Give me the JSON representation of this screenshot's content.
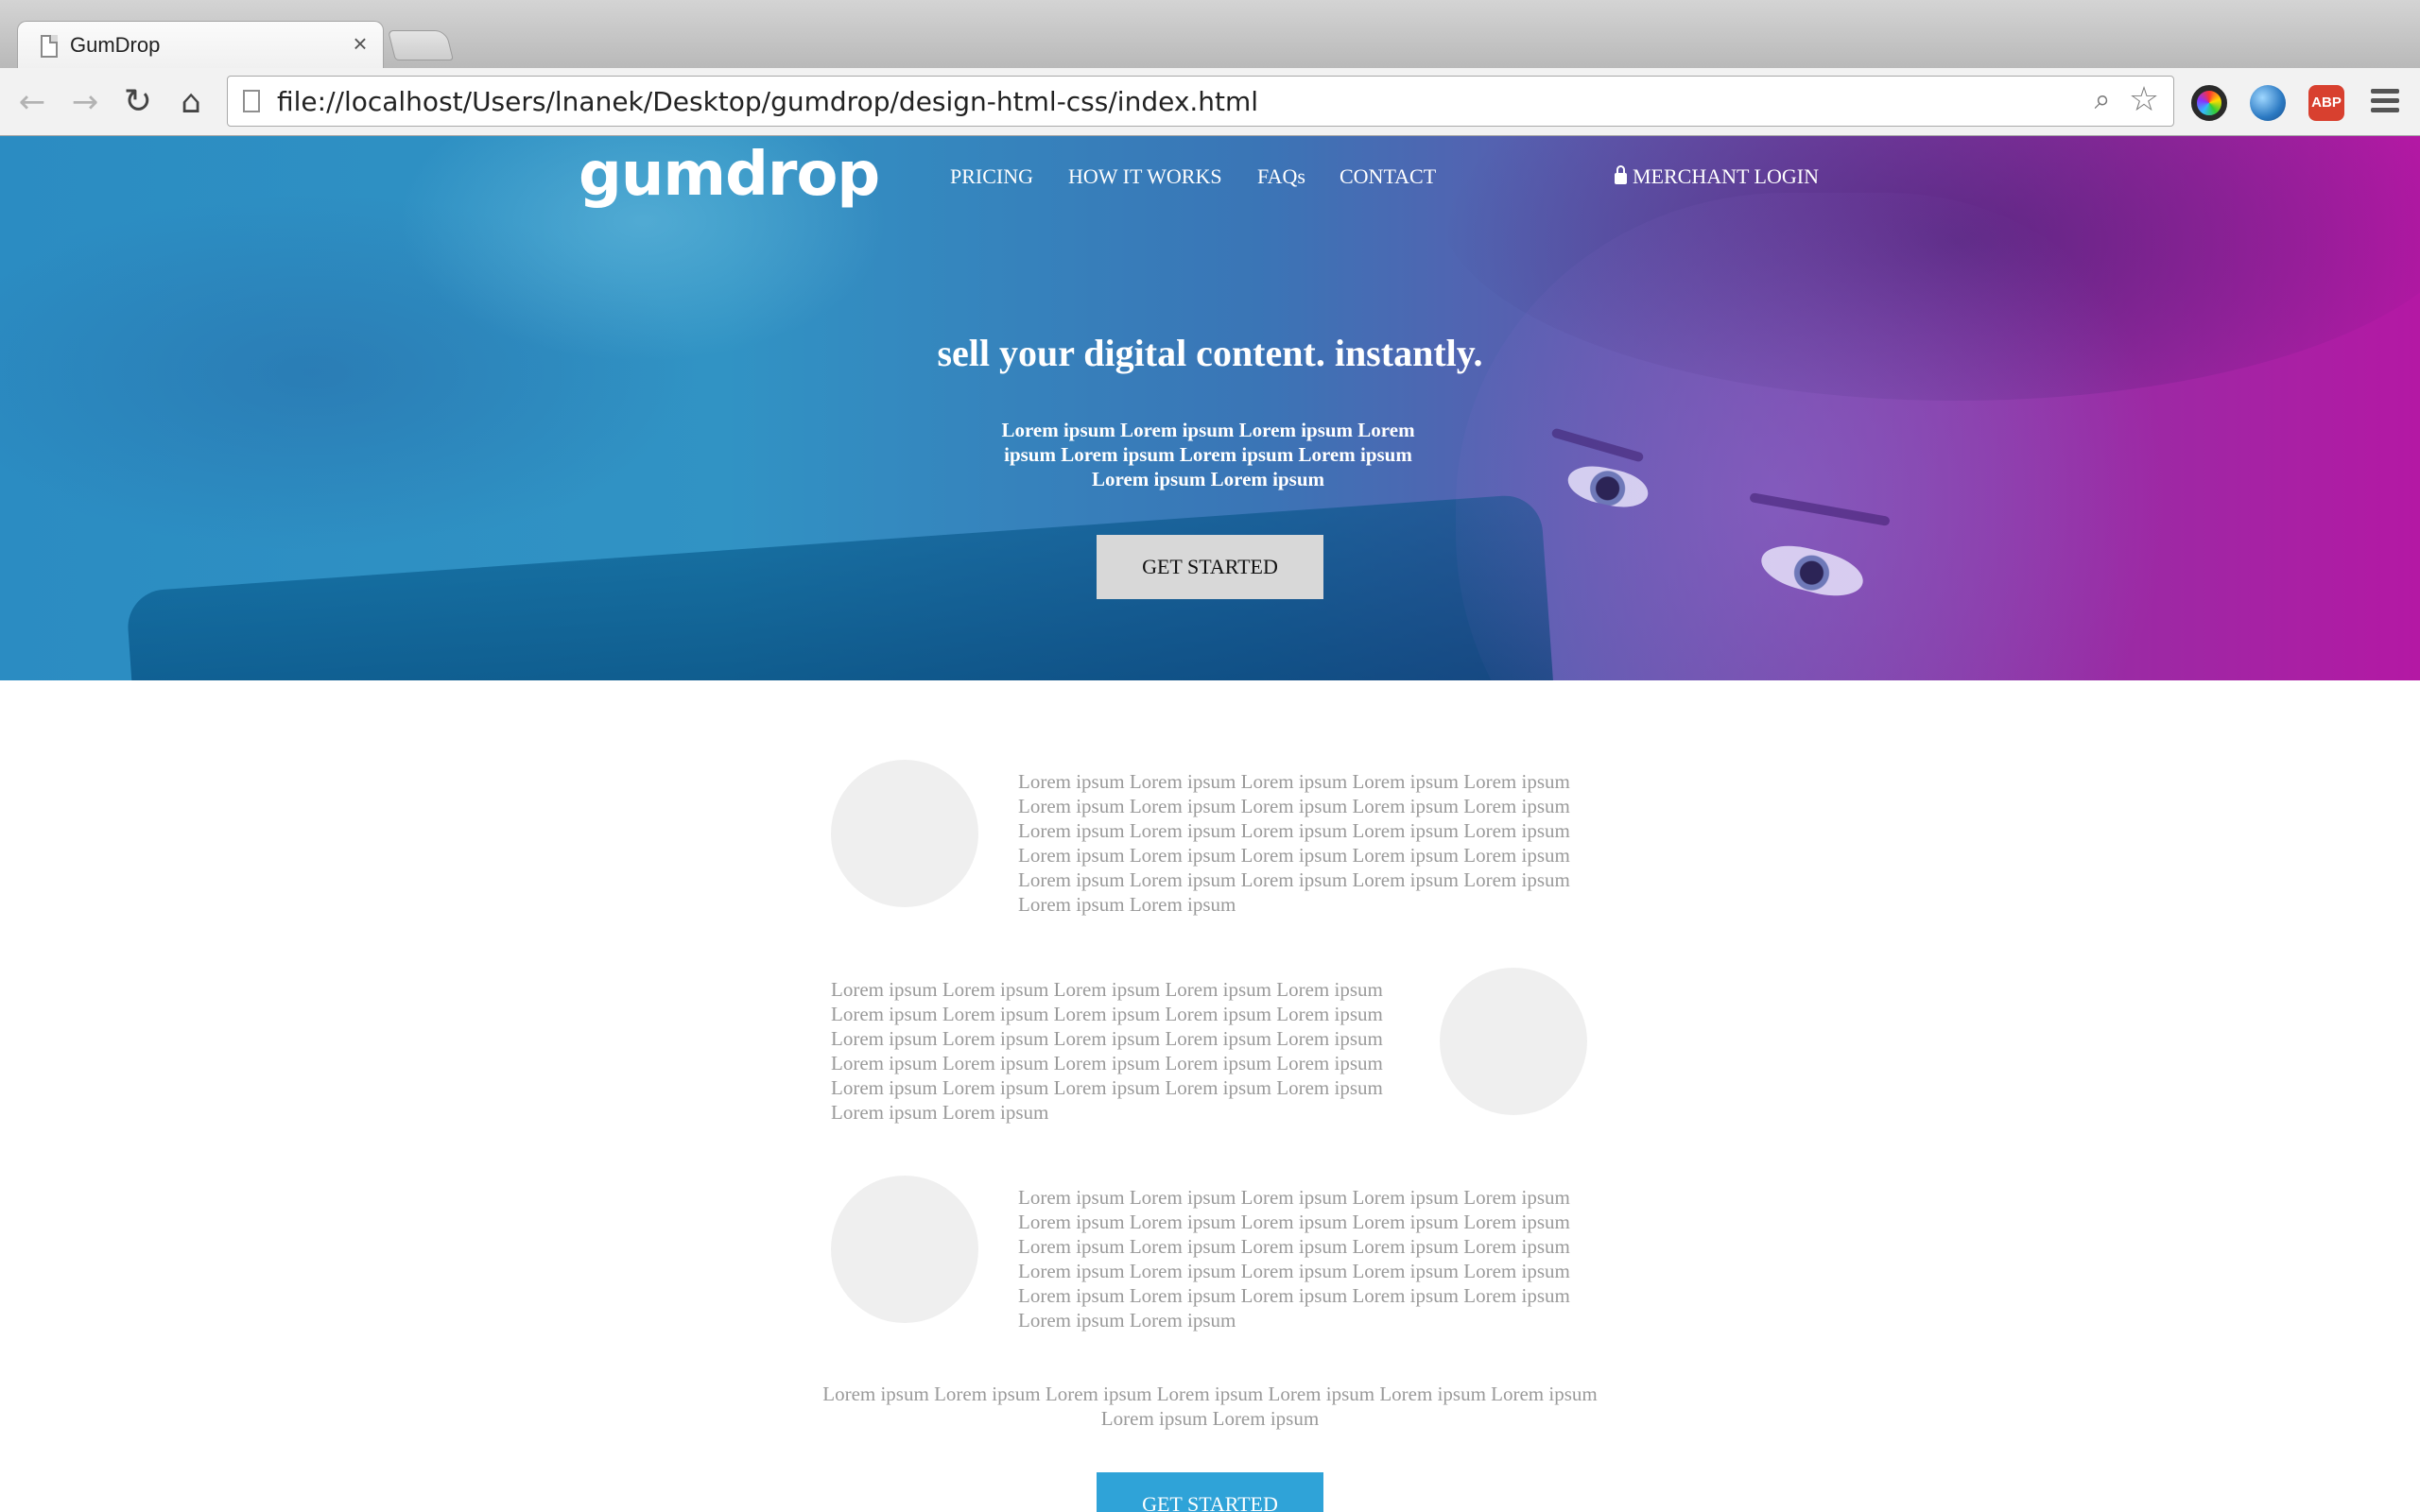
{
  "browser": {
    "tab_title": "GumDrop",
    "tab_close": "×",
    "url": "file://localhost/Users/lnanek/Desktop/gumdrop/design-html-css/index.html",
    "back_icon": "arrow-left-icon",
    "forward_icon": "arrow-right-icon",
    "reload_icon": "reload-icon",
    "home_icon": "home-icon",
    "zoom_icon": "magnifier-icon",
    "bookmark_icon": "star-icon",
    "extensions": [
      "color-picker-icon",
      "globe-icon",
      "adblock-plus-icon"
    ],
    "abp_label": "ABP",
    "menu_icon": "hamburger-menu-icon"
  },
  "site": {
    "logo": "gumdrop",
    "nav": {
      "pricing": "PRICING",
      "how_it_works": "HOW IT WORKS",
      "faqs": "FAQs",
      "contact": "CONTACT"
    },
    "merchant_login": "MERCHANT LOGIN",
    "hero": {
      "title": "sell your digital content. instantly.",
      "body": "Lorem ipsum Lorem ipsum Lorem ipsum Lorem ipsum Lorem ipsum Lorem ipsum Lorem ipsum Lorem ipsum Lorem ipsum",
      "cta": "GET STARTED",
      "gradient_start": "#2b8cc2",
      "gradient_end": "#b418a4"
    },
    "features": [
      {
        "text": "Lorem ipsum Lorem ipsum Lorem ipsum Lorem ipsum Lorem ipsum Lorem ipsum Lorem ipsum Lorem ipsum Lorem ipsum Lorem ipsum Lorem ipsum Lorem ipsum Lorem ipsum Lorem ipsum Lorem ipsum Lorem ipsum Lorem ipsum Lorem ipsum Lorem ipsum Lorem ipsum Lorem ipsum Lorem ipsum Lorem ipsum Lorem ipsum Lorem ipsum Lorem ipsum Lorem ipsum"
      },
      {
        "text": "Lorem ipsum Lorem ipsum Lorem ipsum Lorem ipsum Lorem ipsum Lorem ipsum Lorem ipsum Lorem ipsum Lorem ipsum Lorem ipsum Lorem ipsum Lorem ipsum Lorem ipsum Lorem ipsum Lorem ipsum Lorem ipsum Lorem ipsum Lorem ipsum Lorem ipsum Lorem ipsum Lorem ipsum Lorem ipsum Lorem ipsum Lorem ipsum Lorem ipsum Lorem ipsum Lorem ipsum"
      },
      {
        "text": "Lorem ipsum Lorem ipsum Lorem ipsum Lorem ipsum Lorem ipsum Lorem ipsum Lorem ipsum Lorem ipsum Lorem ipsum Lorem ipsum Lorem ipsum Lorem ipsum Lorem ipsum Lorem ipsum Lorem ipsum Lorem ipsum Lorem ipsum Lorem ipsum Lorem ipsum Lorem ipsum Lorem ipsum Lorem ipsum Lorem ipsum Lorem ipsum Lorem ipsum Lorem ipsum Lorem ipsum"
      }
    ],
    "closing_text": "Lorem ipsum Lorem ipsum Lorem ipsum Lorem ipsum Lorem ipsum Lorem ipsum Lorem ipsum Lorem ipsum Lorem ipsum",
    "bottom_cta": "GET STARTED",
    "accent": "#2fa3d8",
    "feature_circle_color": "#efefef"
  }
}
